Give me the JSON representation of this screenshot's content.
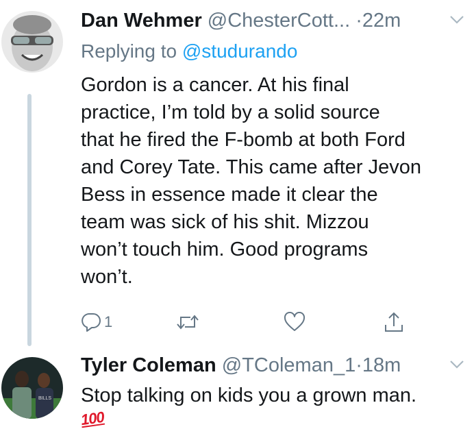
{
  "colors": {
    "text": "#14171a",
    "secondary": "#657786",
    "link": "#1da1f2",
    "thread_line": "#c9d6df",
    "emoji_red": "#e0192b"
  },
  "tweets": [
    {
      "name": "Dan Wehmer",
      "handle": "@ChesterCott...",
      "separator": "·",
      "time": "22m",
      "reply_prefix": "Replying to",
      "reply_mention": "@studurando",
      "body_lines": [
        "Gordon is a cancer. At his final",
        "practice, I’m told by a solid source",
        "that he fired the F-bomb at both Ford",
        "and Corey Tate. This came after Jevon",
        "Bess in essence made it clear the",
        "team was sick of his shit. Mizzou",
        "won’t touch him. Good programs",
        "won’t."
      ],
      "actions": {
        "reply_icon": "reply-icon",
        "reply_count": "1",
        "retweet_icon": "retweet-icon",
        "like_icon": "heart-icon",
        "share_icon": "share-icon"
      },
      "menu_icon": "chevron-down-icon"
    },
    {
      "name": "Tyler Coleman",
      "handle": "@TColeman_1",
      "separator": "·",
      "time": "18m",
      "body_lines": [
        "Stop talking on kids you a grown man."
      ],
      "emoji": "100",
      "menu_icon": "chevron-down-icon"
    }
  ]
}
